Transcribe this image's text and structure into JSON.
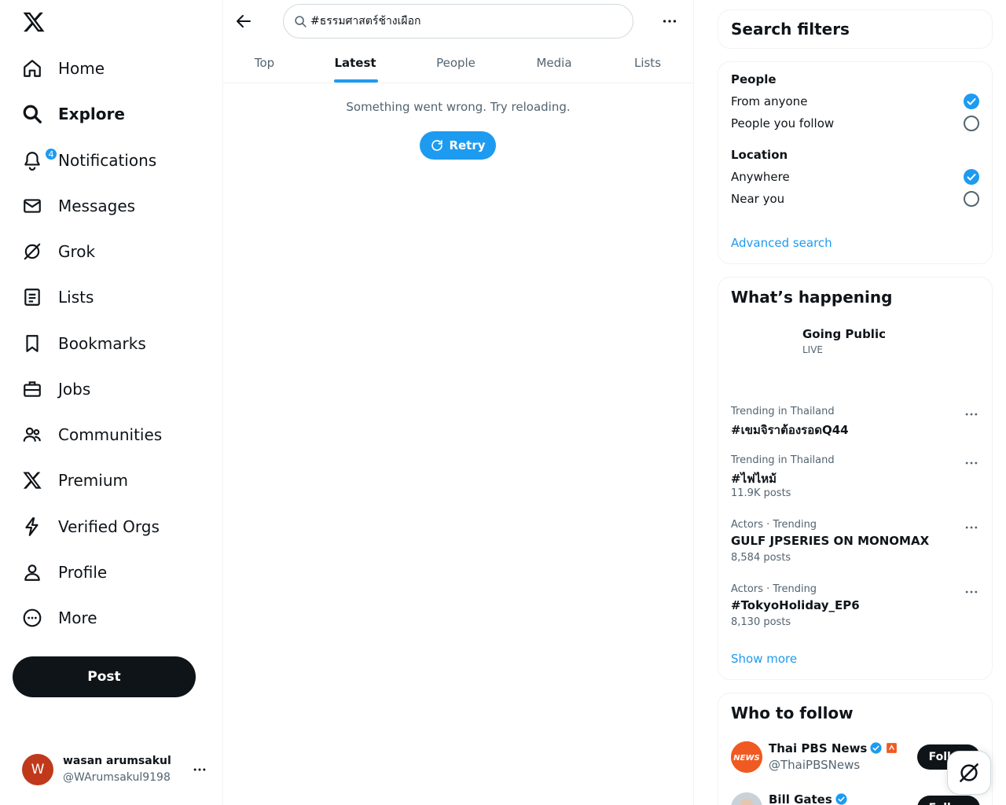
{
  "nav": {
    "items": [
      {
        "id": "home",
        "label": "Home",
        "icon": "home-icon"
      },
      {
        "id": "explore",
        "label": "Explore",
        "icon": "search-icon"
      },
      {
        "id": "notifications",
        "label": "Notifications",
        "icon": "bell-icon",
        "badge": "4"
      },
      {
        "id": "messages",
        "label": "Messages",
        "icon": "envelope-icon"
      },
      {
        "id": "grok",
        "label": "Grok",
        "icon": "grok-icon"
      },
      {
        "id": "lists",
        "label": "Lists",
        "icon": "list-icon"
      },
      {
        "id": "bookmarks",
        "label": "Bookmarks",
        "icon": "bookmark-icon"
      },
      {
        "id": "jobs",
        "label": "Jobs",
        "icon": "briefcase-icon"
      },
      {
        "id": "communities",
        "label": "Communities",
        "icon": "people-icon"
      },
      {
        "id": "premium",
        "label": "Premium",
        "icon": "x-logo-icon"
      },
      {
        "id": "verified_orgs",
        "label": "Verified Orgs",
        "icon": "lightning-icon"
      },
      {
        "id": "profile",
        "label": "Profile",
        "icon": "person-icon"
      },
      {
        "id": "more",
        "label": "More",
        "icon": "more-circle-icon"
      }
    ],
    "active": "explore",
    "post_label": "Post"
  },
  "account": {
    "initial": "W",
    "name": "wasan arumsakul",
    "handle": "@WArumsakul9198"
  },
  "search": {
    "query": "#ธรรมศาสตร์ช้างเผือก"
  },
  "tabs": [
    {
      "label": "Top"
    },
    {
      "label": "Latest",
      "active": true
    },
    {
      "label": "People"
    },
    {
      "label": "Media"
    },
    {
      "label": "Lists"
    }
  ],
  "main": {
    "error_message": "Something went wrong. Try reloading.",
    "retry_label": "Retry"
  },
  "filters": {
    "title": "Search filters",
    "people_heading": "People",
    "people_options": [
      {
        "label": "From anyone",
        "checked": true
      },
      {
        "label": "People you follow",
        "checked": false
      }
    ],
    "location_heading": "Location",
    "location_options": [
      {
        "label": "Anywhere",
        "checked": true
      },
      {
        "label": "Near you",
        "checked": false
      }
    ],
    "advanced_link": "Advanced search"
  },
  "happening": {
    "title": "What’s happening",
    "live": {
      "title": "Going Public",
      "status": "LIVE"
    },
    "trends": [
      {
        "meta": "Trending in Thailand",
        "name": "#เขมจิราต้องรอดQ44",
        "count": ""
      },
      {
        "meta": "Trending in Thailand",
        "name": "#ไฟไหม้",
        "count": "11.9K posts"
      },
      {
        "meta": "Actors · Trending",
        "name": "GULF JPSERIES ON MONOMAX",
        "count": "8,584 posts"
      },
      {
        "meta": "Actors · Trending",
        "name": "#TokyoHoliday_EP6",
        "count": "8,130 posts"
      }
    ],
    "show_more": "Show more"
  },
  "who_to_follow": {
    "title": "Who to follow",
    "accounts": [
      {
        "name": "Thai PBS News",
        "handle": "@ThaiPBSNews",
        "follow_label": "Follow",
        "avatar_text": "NEWS"
      },
      {
        "name": "Bill Gates",
        "handle": "",
        "follow_label": "Follow"
      }
    ]
  },
  "colors": {
    "accent": "#1d9bf0",
    "text": "#0f1419",
    "muted": "#536471",
    "avatar": "#c0391b",
    "pbs": "#f05a22"
  }
}
